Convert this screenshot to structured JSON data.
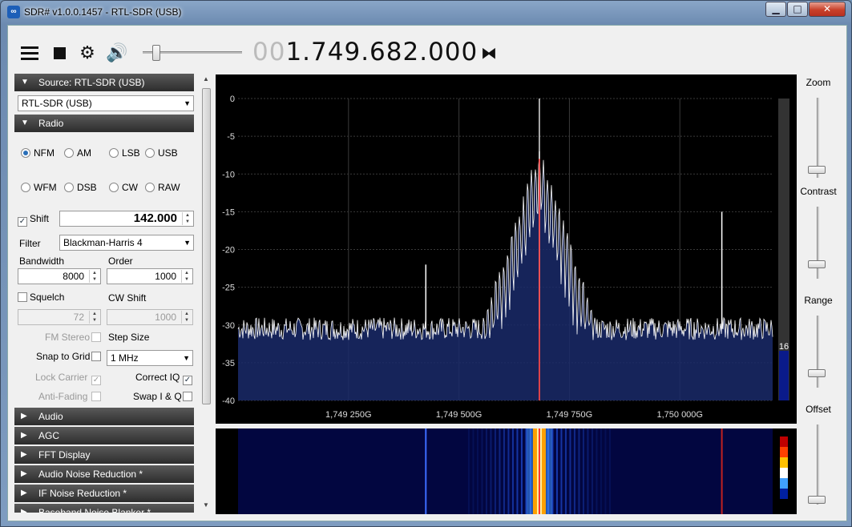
{
  "window": {
    "title": "SDR# v1.0.0.1457 - RTL-SDR (USB)",
    "minimize": "▁",
    "maximize": "□",
    "close": "✕"
  },
  "toolbar": {
    "menu_icon": "menu-icon",
    "stop_icon": "stop-icon",
    "settings_icon": "gear-icon",
    "volume_icon": "speaker-icon",
    "volume_level": 0.1,
    "freq_leading": "00",
    "freq_main": "1.749.682.000",
    "swap_icon": "center-tune-icon"
  },
  "source": {
    "header": "Source: RTL-SDR (USB)",
    "device": "RTL-SDR (USB)"
  },
  "radio": {
    "header": "Radio",
    "modes_row1": [
      "NFM",
      "AM",
      "LSB",
      "USB"
    ],
    "modes_row2": [
      "WFM",
      "DSB",
      "CW",
      "RAW"
    ],
    "selected_mode": "NFM",
    "shift_label": "Shift",
    "shift_checked": true,
    "shift_value": "142.000",
    "filter_label": "Filter",
    "filter_value": "Blackman-Harris 4",
    "bandwidth_label": "Bandwidth",
    "bandwidth_value": "8000",
    "order_label": "Order",
    "order_value": "1000",
    "squelch_label": "Squelch",
    "squelch_checked": false,
    "squelch_value": "72",
    "cwshift_label": "CW Shift",
    "cwshift_value": "1000",
    "fmstereo_label": "FM Stereo",
    "stepsize_label": "Step Size",
    "snap_label": "Snap to Grid",
    "step_value": "1 MHz",
    "lock_label": "Lock Carrier",
    "correctiq_label": "Correct IQ",
    "antifading_label": "Anti-Fading",
    "swapiq_label": "Swap I & Q"
  },
  "collapsed_panels": [
    "Audio",
    "AGC",
    "FFT Display",
    "Audio Noise Reduction *",
    "IF Noise Reduction *",
    "Baseband Noise Blanker *"
  ],
  "right": {
    "zoom": "Zoom",
    "contrast": "Contrast",
    "range": "Range",
    "offset": "Offset",
    "level_value": "16"
  },
  "colors": {
    "spectrum_fill": "#1a2a6a",
    "trace": "#ffffff",
    "tuned_line": "#ff3030",
    "grid": "#3a3a3a"
  },
  "chart_data": {
    "type": "line",
    "y_ticks": [
      "0",
      "-5",
      "-10",
      "-15",
      "-20",
      "-25",
      "-30",
      "-35",
      "-40"
    ],
    "ylim": [
      -40,
      0
    ],
    "x_ticks": [
      "1,749 250G",
      "1,749 500G",
      "1,749 750G",
      "1,750 000G"
    ],
    "xlim": [
      1749000000,
      1750210000
    ],
    "noise_floor_db": -30.5,
    "peaks": [
      {
        "freq": 1749682000,
        "db": -7
      },
      {
        "freq": 1749425000,
        "db": -22
      },
      {
        "freq": 1750095000,
        "db": -15
      }
    ],
    "center_line_freq": 1749682000,
    "grid": true
  }
}
